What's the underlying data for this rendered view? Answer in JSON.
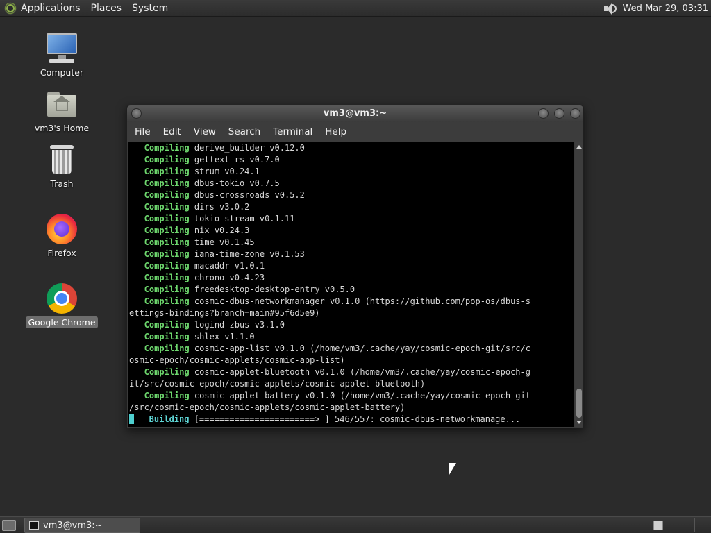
{
  "top_panel": {
    "menus": [
      "Applications",
      "Places",
      "System"
    ],
    "clock": "Wed Mar 29, 03:31"
  },
  "desktop_icons": {
    "computer": "Computer",
    "home": "vm3's Home",
    "trash": "Trash",
    "firefox": "Firefox",
    "chrome": "Google Chrome"
  },
  "window": {
    "title": "vm3@vm3:~",
    "menu": [
      "File",
      "Edit",
      "View",
      "Search",
      "Terminal",
      "Help"
    ]
  },
  "terminal": {
    "lines": [
      {
        "kw": "   Compiling",
        "text": " derive_builder v0.12.0"
      },
      {
        "kw": "   Compiling",
        "text": " gettext-rs v0.7.0"
      },
      {
        "kw": "   Compiling",
        "text": " strum v0.24.1"
      },
      {
        "kw": "   Compiling",
        "text": " dbus-tokio v0.7.5"
      },
      {
        "kw": "   Compiling",
        "text": " dbus-crossroads v0.5.2"
      },
      {
        "kw": "   Compiling",
        "text": " dirs v3.0.2"
      },
      {
        "kw": "   Compiling",
        "text": " tokio-stream v0.1.11"
      },
      {
        "kw": "   Compiling",
        "text": " nix v0.24.3"
      },
      {
        "kw": "   Compiling",
        "text": " time v0.1.45"
      },
      {
        "kw": "   Compiling",
        "text": " iana-time-zone v0.1.53"
      },
      {
        "kw": "   Compiling",
        "text": " macaddr v1.0.1"
      },
      {
        "kw": "   Compiling",
        "text": " chrono v0.4.23"
      },
      {
        "kw": "   Compiling",
        "text": " freedesktop-desktop-entry v0.5.0"
      },
      {
        "kw": "   Compiling",
        "text": " cosmic-dbus-networkmanager v0.1.0 (https://github.com/pop-os/dbus-s"
      },
      {
        "kw": "",
        "text": "ettings-bindings?branch=main#95f6d5e9)"
      },
      {
        "kw": "   Compiling",
        "text": " logind-zbus v3.1.0"
      },
      {
        "kw": "   Compiling",
        "text": " shlex v1.1.0"
      },
      {
        "kw": "   Compiling",
        "text": " cosmic-app-list v0.1.0 (/home/vm3/.cache/yay/cosmic-epoch-git/src/c"
      },
      {
        "kw": "",
        "text": "osmic-epoch/cosmic-applets/cosmic-app-list)"
      },
      {
        "kw": "   Compiling",
        "text": " cosmic-applet-bluetooth v0.1.0 (/home/vm3/.cache/yay/cosmic-epoch-g"
      },
      {
        "kw": "",
        "text": "it/src/cosmic-epoch/cosmic-applets/cosmic-applet-bluetooth)"
      },
      {
        "kw": "   Compiling",
        "text": " cosmic-applet-battery v0.1.0 (/home/vm3/.cache/yay/cosmic-epoch-git"
      },
      {
        "kw": "",
        "text": "/src/cosmic-epoch/cosmic-applets/cosmic-applet-battery)"
      }
    ],
    "building_label": "    Building",
    "building_text": " [=======================> ] 546/557: cosmic-dbus-networkmanage..."
  },
  "bottom_panel": {
    "task_label": "vm3@vm3:~"
  },
  "icons": {
    "logo": "distro-logo-icon",
    "volume": "speaker-icon",
    "terminal": "terminal-icon"
  }
}
